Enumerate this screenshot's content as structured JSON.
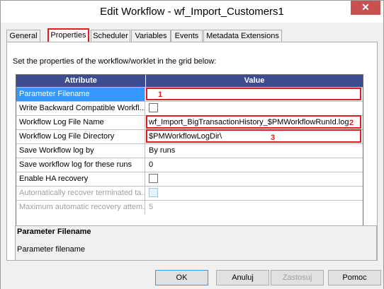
{
  "window": {
    "title": "Edit Workflow - wf_Import_Customers1",
    "close_glyph": "✕"
  },
  "tabs": [
    {
      "label": "General",
      "active": false
    },
    {
      "label": "Properties",
      "active": true
    },
    {
      "label": "Scheduler",
      "active": false
    },
    {
      "label": "Variables",
      "active": false
    },
    {
      "label": "Events",
      "active": false
    },
    {
      "label": "Metadata Extensions",
      "active": false
    }
  ],
  "properties": {
    "description": "Set the properties of the workflow/worklet in the grid below:",
    "columns": {
      "attribute": "Attribute",
      "value": "Value"
    },
    "rows": [
      {
        "attribute": "Parameter Filename",
        "value": "",
        "type": "text",
        "selected": true,
        "disabled": false
      },
      {
        "attribute": "Write Backward Compatible Workfl...",
        "value": "",
        "type": "checkbox",
        "selected": false,
        "disabled": false
      },
      {
        "attribute": "Workflow Log File Name",
        "value": "wf_Import_BigTransactionHistory_$PMWorkflowRunId.log",
        "type": "text",
        "selected": false,
        "disabled": false
      },
      {
        "attribute": "Workflow Log File Directory",
        "value": "$PMWorkflowLogDir\\",
        "type": "text",
        "selected": false,
        "disabled": false
      },
      {
        "attribute": "Save Workflow log by",
        "value": "By runs",
        "type": "text",
        "selected": false,
        "disabled": false
      },
      {
        "attribute": "Save workflow log for these runs",
        "value": "0",
        "type": "text",
        "selected": false,
        "disabled": false
      },
      {
        "attribute": "Enable HA recovery",
        "value": "",
        "type": "checkbox",
        "selected": false,
        "disabled": false
      },
      {
        "attribute": "Automatically recover terminated ta...",
        "value": "",
        "type": "checkbox",
        "selected": false,
        "disabled": true
      },
      {
        "attribute": "Maximum automatic recovery attem...",
        "value": "5",
        "type": "text",
        "selected": false,
        "disabled": true
      }
    ],
    "annotations": [
      "1",
      "2",
      "3"
    ]
  },
  "help": {
    "title": "Parameter Filename",
    "description": "Parameter filename"
  },
  "buttons": {
    "ok": "OK",
    "cancel": "Anuluj",
    "apply": "Zastosuj",
    "help": "Pomoc"
  },
  "colors": {
    "header_bg": "#3d4b8f",
    "selection": "#3399ff",
    "annotation": "#e31b23"
  }
}
